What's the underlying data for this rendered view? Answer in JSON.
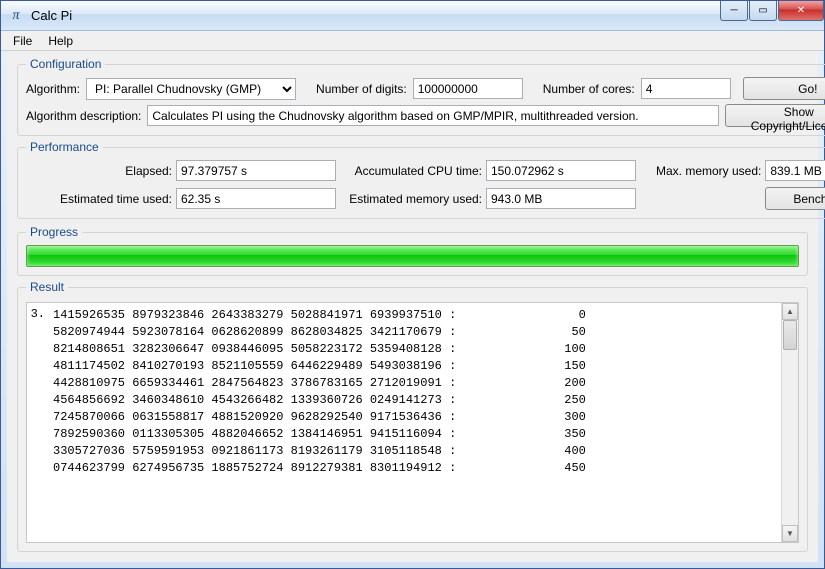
{
  "window": {
    "title": "Calc Pi",
    "icon_glyph": "π"
  },
  "menubar": {
    "items": [
      "File",
      "Help"
    ]
  },
  "configuration": {
    "legend": "Configuration",
    "algorithm_label": "Algorithm:",
    "algorithm_value": "PI: Parallel Chudnovsky (GMP)",
    "digits_label": "Number of digits:",
    "digits_value": "100000000",
    "cores_label": "Number of cores:",
    "cores_value": "4",
    "go_button": "Go!",
    "desc_label": "Algorithm description:",
    "desc_value": "Calculates PI using the Chudnovsky algorithm based on GMP/MPIR, multithreaded version.",
    "license_button": "Show Copyright/License"
  },
  "performance": {
    "legend": "Performance",
    "elapsed_label": "Elapsed:",
    "elapsed_value": "97.379757 s",
    "cpu_label": "Accumulated CPU time:",
    "cpu_value": "150.072962 s",
    "mem_label": "Max. memory used:",
    "mem_value": "839.1 MB",
    "est_time_label": "Estimated time used:",
    "est_time_value": "62.35 s",
    "est_mem_label": "Estimated memory used:",
    "est_mem_value": "943.0 MB",
    "benchmark_button": "Benchmark!"
  },
  "progress": {
    "legend": "Progress"
  },
  "result": {
    "legend": "Result",
    "prefix": "3.",
    "lines": [
      "1415926535 8979323846 2643383279 5028841971 6939937510 :                 0",
      "5820974944 5923078164 0628620899 8628034825 3421170679 :                50",
      "8214808651 3282306647 0938446095 5058223172 5359408128 :               100",
      "4811174502 8410270193 8521105559 6446229489 5493038196 :               150",
      "4428810975 6659334461 2847564823 3786783165 2712019091 :               200",
      "4564856692 3460348610 4543266482 1339360726 0249141273 :               250",
      "7245870066 0631558817 4881520920 9628292540 9171536436 :               300",
      "7892590360 0113305305 4882046652 1384146951 9415116094 :               350",
      "3305727036 5759591953 0921861173 8193261179 3105118548 :               400",
      "0744623799 6274956735 1885752724 8912279381 8301194912 :               450"
    ]
  }
}
